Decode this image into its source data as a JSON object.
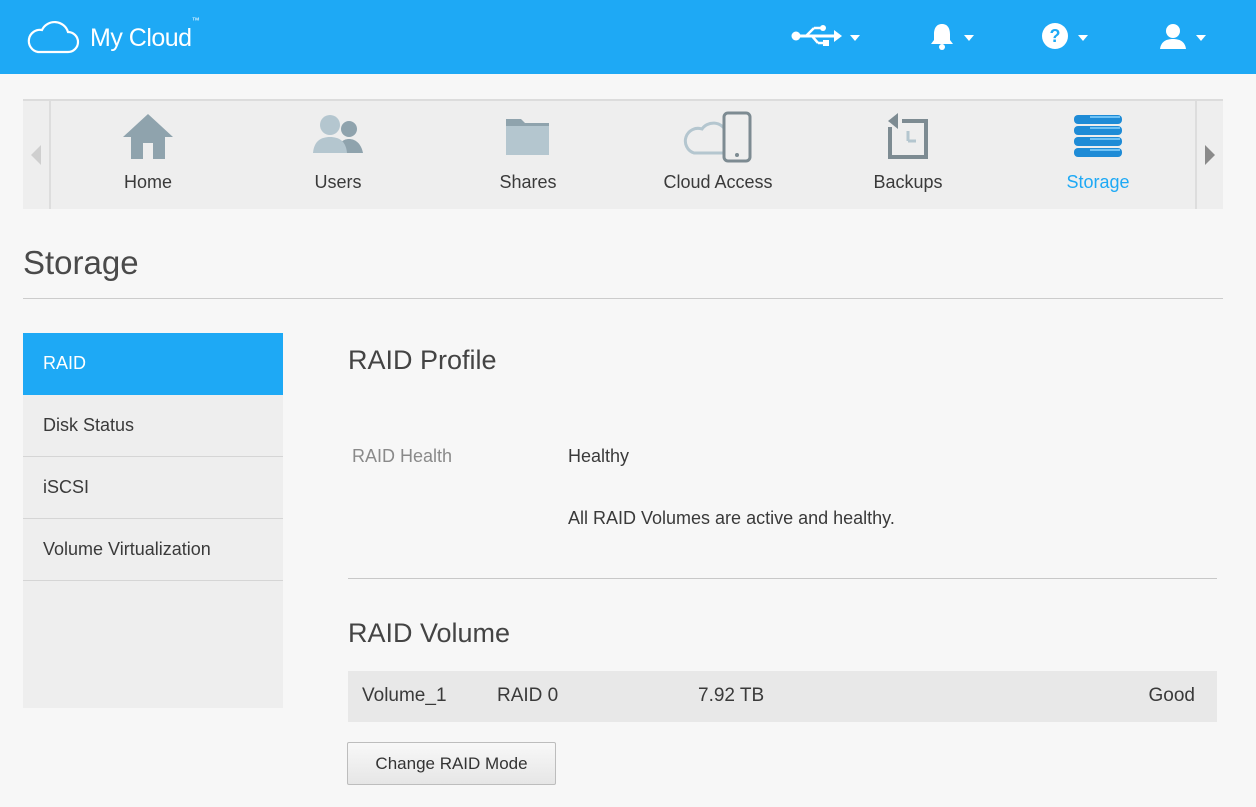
{
  "header": {
    "logo_text": "My Cloud",
    "logo_tm": "™",
    "icons": [
      "cloud-icon",
      "usb-icon",
      "bell-icon",
      "help-icon",
      "user-icon"
    ],
    "colors": {
      "bar": "#1ea9f5",
      "accent": "#1ea9f5"
    }
  },
  "nav": {
    "items": [
      {
        "label": "Home",
        "icon": "home-icon"
      },
      {
        "label": "Users",
        "icon": "users-icon"
      },
      {
        "label": "Shares",
        "icon": "folder-icon"
      },
      {
        "label": "Cloud Access",
        "icon": "cloud-device-icon"
      },
      {
        "label": "Backups",
        "icon": "backup-icon"
      },
      {
        "label": "Storage",
        "icon": "storage-icon",
        "active": true
      }
    ]
  },
  "page": {
    "title": "Storage"
  },
  "side": {
    "items": [
      {
        "label": "RAID",
        "active": true
      },
      {
        "label": "Disk Status"
      },
      {
        "label": "iSCSI"
      },
      {
        "label": "Volume Virtualization"
      }
    ]
  },
  "raid_profile": {
    "heading": "RAID Profile",
    "health_label": "RAID Health",
    "health_value": "Healthy",
    "health_message": "All RAID Volumes are active and healthy."
  },
  "raid_volume": {
    "heading": "RAID Volume",
    "rows": [
      {
        "name": "Volume_1",
        "mode": "RAID 0",
        "size": "7.92 TB",
        "status": "Good"
      }
    ],
    "change_button": "Change RAID Mode"
  }
}
